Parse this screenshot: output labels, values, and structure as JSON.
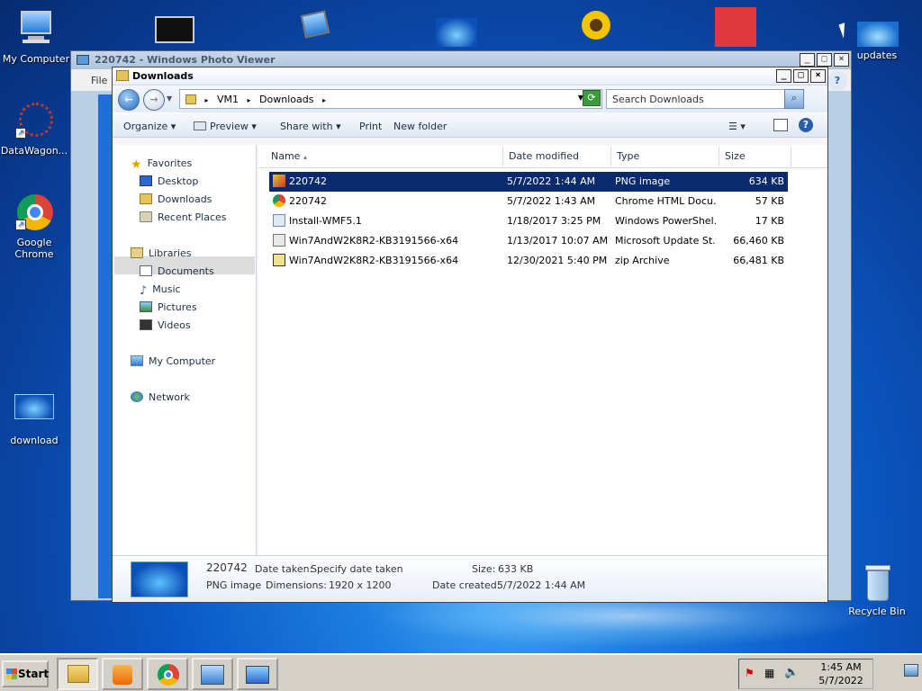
{
  "desktop": {
    "icons": [
      {
        "label": "My Computer"
      },
      {
        "label": "DataWagon..."
      },
      {
        "label": "Google Chrome"
      },
      {
        "label": "download"
      },
      {
        "label": "updates"
      },
      {
        "label": "Recycle Bin"
      }
    ]
  },
  "photo_viewer": {
    "title": "220742 - Windows Photo Viewer",
    "menu_file": "File"
  },
  "explorer": {
    "title": "Downloads",
    "breadcrumb": [
      "VM1",
      "Downloads"
    ],
    "search_placeholder": "Search Downloads",
    "commands": {
      "organize": "Organize",
      "preview": "Preview",
      "share_with": "Share with",
      "print": "Print",
      "new_folder": "New folder"
    },
    "nav": {
      "favorites": "Favorites",
      "desktop": "Desktop",
      "downloads": "Downloads",
      "recent_places": "Recent Places",
      "libraries": "Libraries",
      "documents": "Documents",
      "music": "Music",
      "pictures": "Pictures",
      "videos": "Videos",
      "my_computer": "My Computer",
      "network": "Network"
    },
    "columns": {
      "name": "Name",
      "date_modified": "Date modified",
      "type": "Type",
      "size": "Size"
    },
    "files": [
      {
        "name": "220742",
        "date": "5/7/2022 1:44 AM",
        "type": "PNG image",
        "size": "634 KB",
        "icon": "png-image-icon"
      },
      {
        "name": "220742",
        "date": "5/7/2022 1:43 AM",
        "type": "Chrome HTML Docu...",
        "size": "57 KB",
        "icon": "chrome-html-icon"
      },
      {
        "name": "Install-WMF5.1",
        "date": "1/18/2017 3:25 PM",
        "type": "Windows PowerShel...",
        "size": "17 KB",
        "icon": "powershell-script-icon"
      },
      {
        "name": "Win7AndW2K8R2-KB3191566-x64",
        "date": "1/13/2017 10:07 AM",
        "type": "Microsoft Update St...",
        "size": "66,460 KB",
        "icon": "update-package-icon"
      },
      {
        "name": "Win7AndW2K8R2-KB3191566-x64",
        "date": "12/30/2021 5:40 PM",
        "type": "zip Archive",
        "size": "66,481 KB",
        "icon": "zip-archive-icon"
      }
    ],
    "details": {
      "name": "220742",
      "date_taken_label": "Date taken:",
      "date_taken": "Specify date taken",
      "type": "PNG image",
      "dimensions_label": "Dimensions:",
      "dimensions": "1920 x 1200",
      "size_label": "Size:",
      "size": "633 KB",
      "created_label": "Date created:",
      "created": "5/7/2022 1:44 AM"
    }
  },
  "taskbar": {
    "start": "Start",
    "time": "1:45 AM",
    "date": "5/7/2022"
  }
}
